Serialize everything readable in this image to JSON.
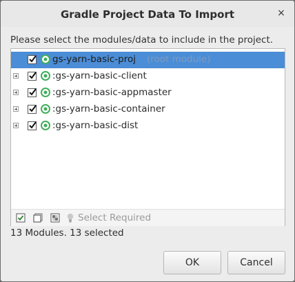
{
  "dialog": {
    "title": "Gradle Project Data To Import",
    "close_glyph": "×",
    "prompt": "Please select the modules/data to include in the project.",
    "tree": {
      "rows": [
        {
          "label": "gs-yarn-basic-proj",
          "suffix": "(root module)",
          "checked": true,
          "selected": true,
          "expandable": false,
          "icon": "gradle-module-icon"
        },
        {
          "label": ":gs-yarn-basic-client",
          "suffix": "",
          "checked": true,
          "selected": false,
          "expandable": true,
          "icon": "gradle-module-icon"
        },
        {
          "label": ":gs-yarn-basic-appmaster",
          "suffix": "",
          "checked": true,
          "selected": false,
          "expandable": true,
          "icon": "gradle-module-icon"
        },
        {
          "label": ":gs-yarn-basic-container",
          "suffix": "",
          "checked": true,
          "selected": false,
          "expandable": true,
          "icon": "gradle-module-icon"
        },
        {
          "label": ":gs-yarn-basic-dist",
          "suffix": "",
          "checked": true,
          "selected": false,
          "expandable": true,
          "icon": "gradle-module-icon"
        }
      ],
      "toolbar": {
        "select_all_icon": "select-all-icon",
        "unselect_all_icon": "unselect-all-icon",
        "invert_icon": "invert-selection-icon",
        "select_required_icon": "lightbulb-icon",
        "select_required_label": "Select Required"
      }
    },
    "status": "13 Modules. 13 selected",
    "buttons": {
      "ok": "OK",
      "cancel": "Cancel"
    },
    "colors": {
      "selection": "#4b8dd6",
      "accent_green": "#3fae5a",
      "suffix_text": "#7f9bbf"
    }
  }
}
